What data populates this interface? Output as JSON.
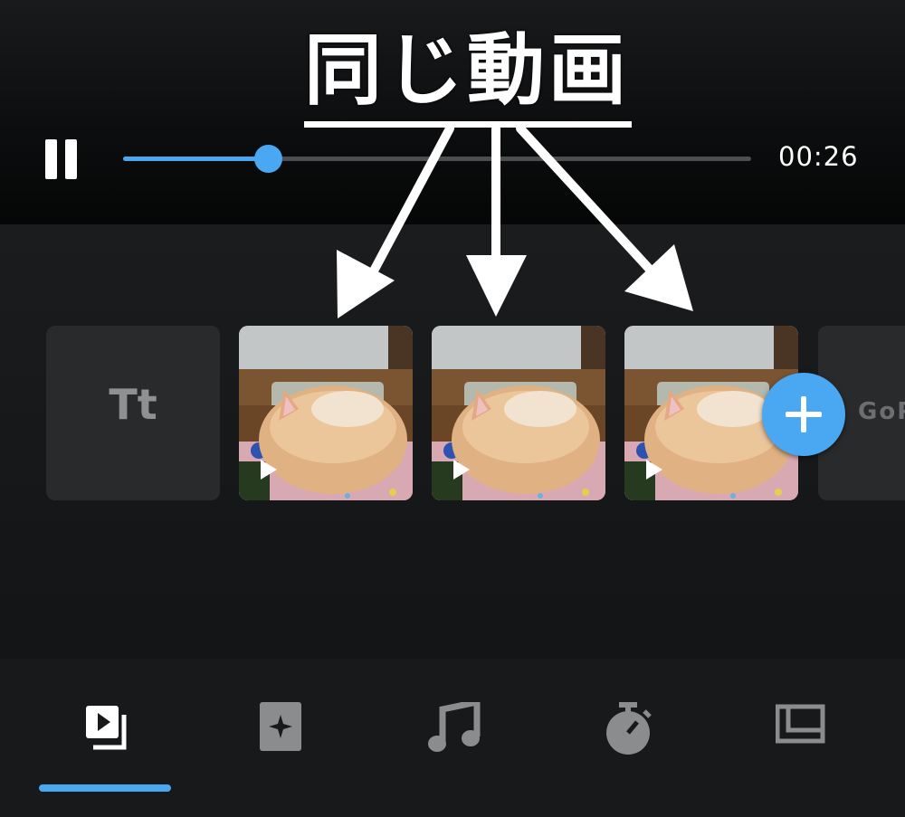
{
  "annotation": {
    "text": "同じ動画"
  },
  "player": {
    "time": "00:26",
    "progress": 0.23
  },
  "timeline": {
    "title_clip_label": "Tt",
    "end_clip_label": "GoPro",
    "video_clips": [
      {
        "icon": "play-icon"
      },
      {
        "icon": "play-icon"
      },
      {
        "icon": "play-icon"
      }
    ],
    "add_button_icon": "plus-icon"
  },
  "tabs": [
    {
      "icon": "clips-icon",
      "selected": true
    },
    {
      "icon": "effects-icon",
      "selected": false
    },
    {
      "icon": "music-icon",
      "selected": false
    },
    {
      "icon": "timer-icon",
      "selected": false
    },
    {
      "icon": "layout-icon",
      "selected": false
    }
  ],
  "colors": {
    "accent": "#4aa8f2",
    "background": "#121416",
    "tab_inactive": "#8a8c8e",
    "tab_active": "#ffffff"
  }
}
